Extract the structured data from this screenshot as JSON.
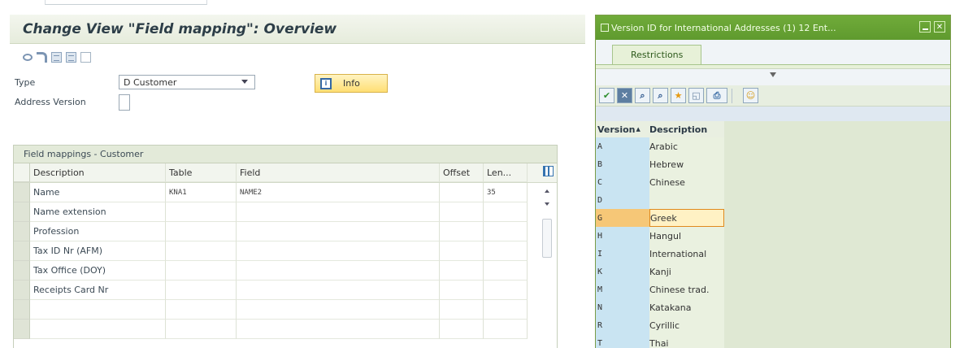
{
  "main": {
    "title": "Change View \"Field mapping\": Overview",
    "toolbar_icons": [
      "display-change-icon",
      "undo-icon",
      "copy-icon",
      "details-icon",
      "select-block-icon"
    ],
    "form": {
      "type_label": "Type",
      "type_value": "D Customer",
      "address_version_label": "Address Version",
      "address_version_value": "",
      "info_label": "Info"
    },
    "table": {
      "title": "Field mappings - Customer",
      "columns": [
        "Description",
        "Table",
        "Field",
        "Offset",
        "Len..."
      ],
      "rows": [
        {
          "description": "Name",
          "table": "KNA1",
          "field": "NAME2",
          "offset": "",
          "length": "35"
        },
        {
          "description": "Name extension",
          "table": "",
          "field": "",
          "offset": "",
          "length": ""
        },
        {
          "description": "Profession",
          "table": "",
          "field": "",
          "offset": "",
          "length": ""
        },
        {
          "description": "Tax ID Nr (AFM)",
          "table": "",
          "field": "",
          "offset": "",
          "length": ""
        },
        {
          "description": "Tax Office (DOY)",
          "table": "",
          "field": "",
          "offset": "",
          "length": ""
        },
        {
          "description": "Receipts Card Nr",
          "table": "",
          "field": "",
          "offset": "",
          "length": ""
        },
        {
          "description": "",
          "table": "",
          "field": "",
          "offset": "",
          "length": ""
        },
        {
          "description": "",
          "table": "",
          "field": "",
          "offset": "",
          "length": ""
        }
      ]
    }
  },
  "popup": {
    "title": "Version ID for International Addresses (1)   12 Ent...",
    "tab_label": "Restrictions",
    "toolbar_icons": [
      "check-icon",
      "cancel-icon",
      "find-icon",
      "find-next-icon",
      "favorite-icon",
      "details-icon",
      "print-icon",
      "personal-list-icon"
    ],
    "list_headers": [
      "Version",
      "Description"
    ],
    "selected_version": "G",
    "rows": [
      {
        "version": "A",
        "description": "Arabic"
      },
      {
        "version": "B",
        "description": "Hebrew"
      },
      {
        "version": "C",
        "description": "Chinese"
      },
      {
        "version": "D",
        "description": ""
      },
      {
        "version": "G",
        "description": "Greek"
      },
      {
        "version": "H",
        "description": "Hangul"
      },
      {
        "version": "I",
        "description": "International"
      },
      {
        "version": "K",
        "description": "Kanji"
      },
      {
        "version": "M",
        "description": "Chinese trad."
      },
      {
        "version": "N",
        "description": "Katakana"
      },
      {
        "version": "R",
        "description": "Cyrillic"
      },
      {
        "version": "T",
        "description": "Thai"
      }
    ]
  }
}
